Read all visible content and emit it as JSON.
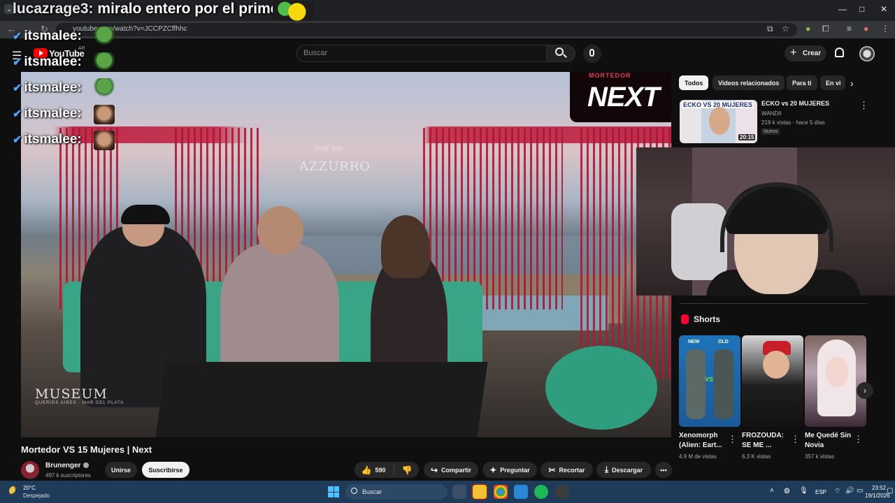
{
  "browser": {
    "url": "youtube.com/watch?v=JCCPZCffhhc",
    "window_controls": {
      "minimize": "—",
      "maximize": "□",
      "close": "✕"
    },
    "nav_icons": [
      "back-icon",
      "forward-icon",
      "reload-icon"
    ]
  },
  "chat": {
    "top_message": {
      "user": "lucazrage3:",
      "text": "miralo entero por el prime"
    },
    "lines": [
      {
        "user": "itsmalee:"
      },
      {
        "user": "itsmalee:"
      },
      {
        "user": "itsmalee:"
      },
      {
        "user": "itsmalee:"
      },
      {
        "user": "itsmalee:"
      }
    ]
  },
  "masthead": {
    "logo_text": "YouTube",
    "country": "AR",
    "search_placeholder": "Buscar",
    "create_label": "Crear"
  },
  "player": {
    "brand_top": "MORTEDOR",
    "brand_main": "NEXT",
    "watermark_roof": "roof top",
    "watermark_azzurro": "AZZURRO",
    "watermark_museum": "MUSEUM",
    "watermark_museum_sub": "QUERIDS AIRES · MAR DEL PLATA"
  },
  "video": {
    "title": "Mortedor VS 15 Mujeres | Next",
    "channel": "Brunenger",
    "subscribers": "497 k suscriptores",
    "join_label": "Unirse",
    "subscribe_label": "Suscribirse",
    "likes": "590",
    "share_label": "Compartir",
    "ask_label": "Preguntar",
    "clip_label": "Recortar",
    "download_label": "Descargar"
  },
  "sidebar": {
    "chips": [
      "Todos",
      "Videos relacionados",
      "Para ti",
      "En vi"
    ],
    "recommendation": {
      "thumb_banner": "ECKO VS 20 MUJERES",
      "title": "ECKO vs 20 MUJERES",
      "channel": "WANDII",
      "meta": "219 k vistas · hace 5 días",
      "badge": "Nuevo",
      "duration": "20:15"
    },
    "shorts_heading": "Shorts",
    "shorts": [
      {
        "title": "Xenomorph (Alien: Eart...",
        "views": "4.9 M de vistas",
        "tag_new": "NEW",
        "tag_old": "OLD",
        "tag_vs": "VS"
      },
      {
        "title": "FROZOUDA: SE ME ...",
        "views": "6.3 K vistas"
      },
      {
        "title": "Me Quedé Sin Novia",
        "views": "357 k vistas"
      }
    ]
  },
  "taskbar": {
    "temperature": "20°C",
    "weather": "Despejado",
    "search_label": "Buscar",
    "language": "ESP",
    "time": "23:52",
    "date": "19/1/2026"
  },
  "colors": {
    "youtube_red": "#ff0000",
    "background": "#0f0f0f",
    "chip_bg": "#272727",
    "taskbar": "#1f3b5a"
  }
}
